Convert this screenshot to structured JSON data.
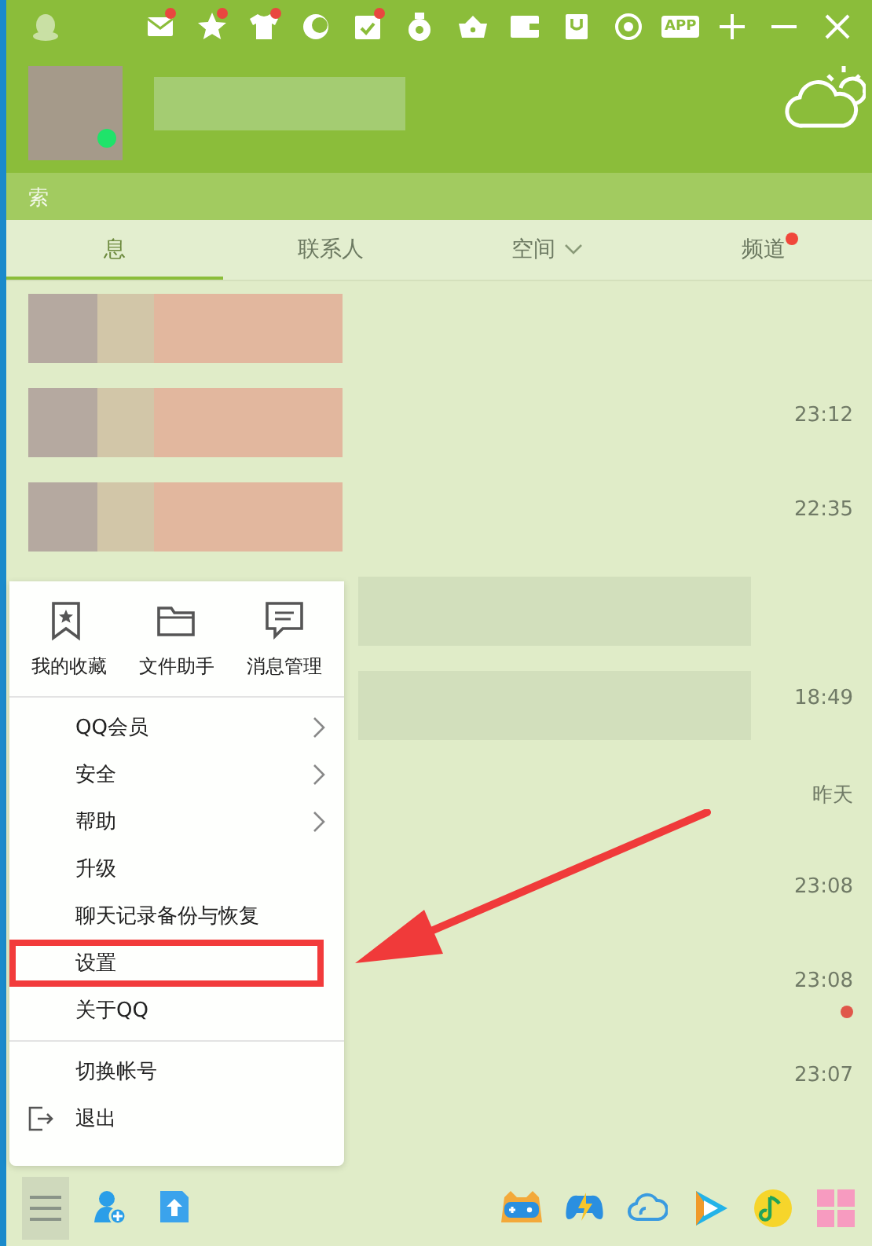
{
  "title_bar": {
    "icons": [
      {
        "kind": "penguin",
        "badge": false
      },
      {
        "kind": "mail",
        "badge": true
      },
      {
        "kind": "star",
        "badge": true
      },
      {
        "kind": "shirt",
        "badge": true
      },
      {
        "kind": "moon",
        "badge": false
      },
      {
        "kind": "calendar",
        "badge": true
      },
      {
        "kind": "medal",
        "badge": false
      },
      {
        "kind": "basket",
        "badge": false
      },
      {
        "kind": "wallet",
        "badge": false
      },
      {
        "kind": "bag",
        "badge": false
      },
      {
        "kind": "ring",
        "badge": false
      },
      {
        "kind": "app",
        "badge": false,
        "label": "APP"
      },
      {
        "kind": "plus",
        "badge": false
      },
      {
        "kind": "minimize",
        "badge": false
      },
      {
        "kind": "close",
        "badge": false
      }
    ]
  },
  "profile": {
    "online": true
  },
  "search": {
    "placeholder": "索"
  },
  "tabs": [
    {
      "label": "息",
      "selected": true,
      "dropdown": false,
      "badge": false
    },
    {
      "label": "联系人",
      "selected": false,
      "dropdown": false,
      "badge": false
    },
    {
      "label": "空间",
      "selected": false,
      "dropdown": true,
      "badge": false
    },
    {
      "label": "频道",
      "selected": false,
      "dropdown": false,
      "badge": true
    }
  ],
  "chats": [
    {
      "blurred": true,
      "unread": false
    },
    {
      "time": "23:12",
      "blurred": true,
      "unread": false
    },
    {
      "time": "22:35",
      "blurred": true,
      "unread": false
    },
    {
      "blurred": true,
      "unread": false
    },
    {
      "time": "18:49",
      "blurred": true,
      "unread": false
    },
    {
      "time": "昨天",
      "blurred": false,
      "unread": false
    },
    {
      "time": "23:08",
      "blurred": false,
      "unread": false
    },
    {
      "time": "23:08",
      "blurred": false,
      "unread": true
    },
    {
      "time": "23:07",
      "blurred": false,
      "unread": false
    }
  ],
  "main_menu": {
    "shortcuts": [
      {
        "kind": "bookmark",
        "label": "我的收藏"
      },
      {
        "kind": "folder",
        "label": "文件助手"
      },
      {
        "kind": "message",
        "label": "消息管理"
      }
    ],
    "items": [
      {
        "label": "QQ会员",
        "kind": "submenu"
      },
      {
        "label": "安全",
        "kind": "submenu"
      },
      {
        "label": "帮助",
        "kind": "submenu"
      },
      {
        "label": "升级",
        "kind": "plain"
      },
      {
        "label": "聊天记录备份与恢复",
        "kind": "plain"
      },
      {
        "label": "设置",
        "kind": "plain",
        "highlighted": true
      },
      {
        "label": "关于QQ",
        "kind": "plain"
      },
      {
        "label": "切换帐号",
        "kind": "plain",
        "separator_before": true
      },
      {
        "label": "退出",
        "kind": "exit"
      }
    ]
  },
  "bottom_bar": {
    "menu_open": true,
    "left": [
      {
        "kind": "add-contact"
      },
      {
        "kind": "upload"
      }
    ],
    "right": [
      {
        "kind": "game"
      },
      {
        "kind": "controller"
      },
      {
        "kind": "cloud"
      },
      {
        "kind": "play"
      },
      {
        "kind": "music"
      },
      {
        "kind": "apps"
      }
    ]
  }
}
